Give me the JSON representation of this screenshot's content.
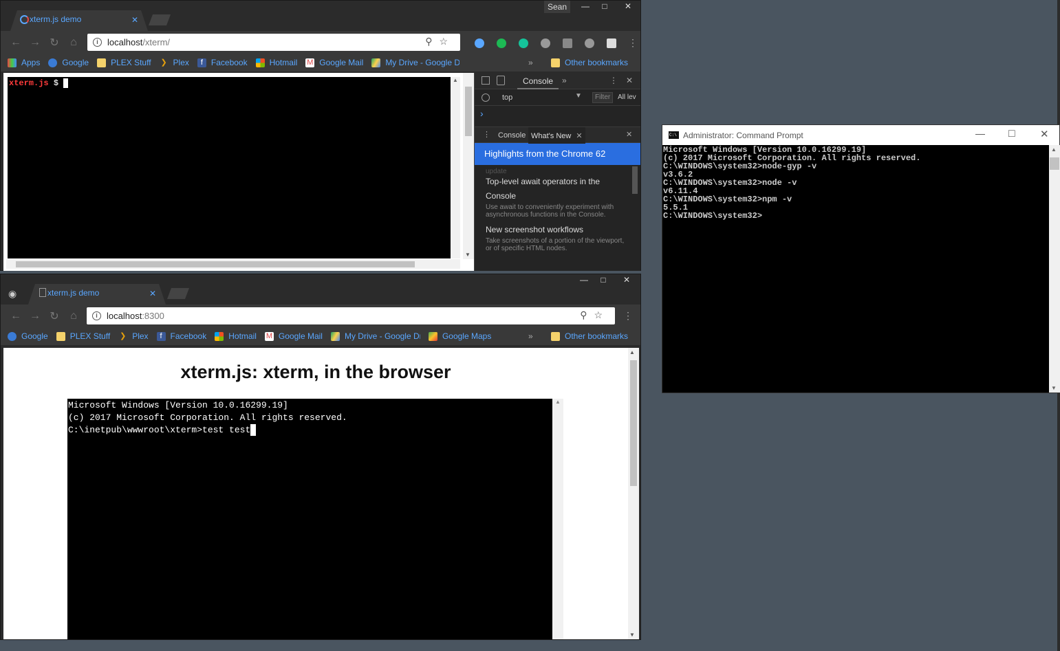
{
  "taskbar": {
    "user": "Sean"
  },
  "win1": {
    "tab_title": "xterm.js demo",
    "url_host": "localhost",
    "url_path": "/xterm/",
    "bookmarks": [
      "Apps",
      "Google",
      "PLEX Stuff",
      "Plex",
      "Facebook",
      "Hotmail",
      "Google Mail",
      "My Drive - Google Dr",
      "Other bookmarks"
    ],
    "bookmarks_more": "»",
    "terminal_prompt_name": "xterm.js",
    "terminal_prompt_symbol": "$",
    "devtools": {
      "tab_console": "Console",
      "more": "»",
      "context": "top",
      "filter_placeholder": "Filter",
      "levels": "All lev",
      "prompt_chevron": "›",
      "drawer_tab_console": "Console",
      "drawer_tab_whatsnew": "What's New",
      "banner": "Highlights from the Chrome 62",
      "faded": "update",
      "items": [
        {
          "title": "Top-level await operators in the Console",
          "desc": "Use await to conveniently experiment with asynchronous functions in the Console."
        },
        {
          "title": "New screenshot workflows",
          "desc": "Take screenshots of a portion of the viewport, or of specific HTML nodes."
        }
      ]
    }
  },
  "win2": {
    "tab_title": "xterm.js demo",
    "url_host": "localhost",
    "url_path": ":8300",
    "bookmarks": [
      "Google",
      "PLEX Stuff",
      "Plex",
      "Facebook",
      "Hotmail",
      "Google Mail",
      "My Drive - Google Dr",
      "Google Maps",
      "Other bookmarks"
    ],
    "bookmarks_more": "»",
    "page_heading": "xterm.js: xterm, in the browser",
    "terminal_lines": [
      "Microsoft Windows [Version 10.0.16299.19]",
      "(c) 2017 Microsoft Corporation. All rights reserved.",
      "",
      "C:\\inetpub\\wwwroot\\xterm>test test"
    ]
  },
  "cmd": {
    "title": "Administrator: Command Prompt",
    "icon_text": "C:\\",
    "lines": [
      "Microsoft Windows [Version 10.0.16299.19]",
      "(c) 2017 Microsoft Corporation. All rights reserved.",
      "",
      "C:\\WINDOWS\\system32>node-gyp -v",
      "v3.6.2",
      "",
      "C:\\WINDOWS\\system32>node -v",
      "v6.11.4",
      "",
      "C:\\WINDOWS\\system32>npm -v",
      "5.5.1",
      "",
      "C:\\WINDOWS\\system32>"
    ]
  },
  "colors": {
    "accent": "#5aa7ff",
    "banner": "#2a6ee0",
    "prompt_red": "#ff3b3b"
  }
}
